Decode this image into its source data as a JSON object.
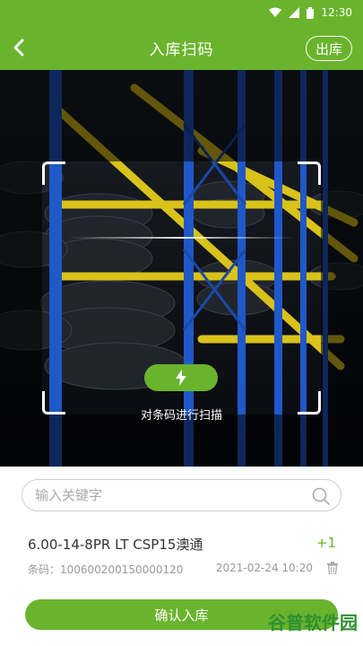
{
  "status_bar": {
    "time": "12:30"
  },
  "header": {
    "title": "入库扫码",
    "right_button": "出库"
  },
  "scanner": {
    "hint": "对条码进行扫描"
  },
  "search": {
    "placeholder": "输入关键字",
    "value": ""
  },
  "items": [
    {
      "name": "6.00-14-8PR LT CSP15澳通",
      "qty": "+1",
      "code": "条码：100600200150000120",
      "time": "2021-02-24 10:20"
    }
  ],
  "footer": {
    "confirm_label": "确认入库"
  },
  "watermark": {
    "text": "谷普软件园"
  },
  "colors": {
    "accent": "#6ab42d",
    "rack_blue": "#1f58c8",
    "rack_yellow": "#d9c21a"
  }
}
